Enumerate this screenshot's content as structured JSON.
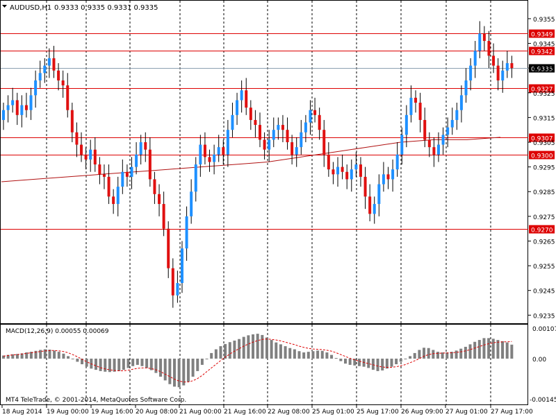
{
  "header": {
    "symbol_label": "AUDUSD,H1",
    "ohlc_label": "0.9333 0.9335 0.9331 0.9335"
  },
  "macd": {
    "label": "MACD(12,26,9) 0.00055 0.00069",
    "scale_labels": [
      "0.00107",
      "0.00",
      "-0.00145"
    ]
  },
  "copyright": "MT4 TeleTrade, © 2001-2014, MetaQuotes Software Corp.",
  "price_axis": {
    "tick_labels": [
      "0.9355",
      "0.9345",
      "0.9335",
      "0.9325",
      "0.9315",
      "0.9305",
      "0.9295",
      "0.9285",
      "0.9275",
      "0.9265",
      "0.9255",
      "0.9245",
      "0.9235"
    ]
  },
  "levels": [
    {
      "label": "0.9349",
      "value": 0.9349
    },
    {
      "label": "0.9342",
      "value": 0.9342
    },
    {
      "label": "0.9327",
      "value": 0.9327
    },
    {
      "label": "0.9307",
      "value": 0.9307
    },
    {
      "label": "0.9300",
      "value": 0.93
    },
    {
      "label": "0.9270",
      "value": 0.927
    }
  ],
  "current_price": {
    "label": "0.9335",
    "value": 0.9335
  },
  "time_axis": {
    "labels": [
      "18 Aug 2014",
      "19 Aug 00:00",
      "19 Aug 16:00",
      "20 Aug 08:00",
      "21 Aug 00:00",
      "21 Aug 16:00",
      "22 Aug 08:00",
      "25 Aug 01:00",
      "25 Aug 17:00",
      "26 Aug 09:00",
      "27 Aug 01:00",
      "27 Aug 17:00"
    ]
  },
  "colors": {
    "bull": "#1e90ff",
    "bear": "#e01010",
    "level_line": "#dd0000",
    "current_line": "#8ca0b0",
    "ma_line": "#b01010",
    "macd_hist": "#808080",
    "macd_signal": "#dd0000",
    "grid": "#000000"
  },
  "chart_data": [
    {
      "type": "candlestick",
      "symbol": "AUDUSD",
      "timeframe": "H1",
      "ylim": [
        0.9232,
        0.9362
      ],
      "ma_series": [
        0.9289,
        0.929,
        0.9291,
        0.9292,
        0.9293,
        0.9294,
        0.9295,
        0.9296,
        0.9297,
        0.9299,
        0.9301,
        0.9303,
        0.9305,
        0.9306,
        0.9306,
        0.9307
      ],
      "close_series": [
        0.9318,
        0.932,
        0.9322,
        0.9316,
        0.932,
        0.9318,
        0.9324,
        0.933,
        0.9333,
        0.9336,
        0.9339,
        0.9334,
        0.933,
        0.9328,
        0.9318,
        0.9309,
        0.9304,
        0.93,
        0.9298,
        0.9302,
        0.9296,
        0.9292,
        0.9291,
        0.9283,
        0.928,
        0.9287,
        0.9293,
        0.9291,
        0.9295,
        0.93,
        0.9305,
        0.9302,
        0.929,
        0.9284,
        0.928,
        0.927,
        0.9254,
        0.9243,
        0.9248,
        0.9262,
        0.9275,
        0.9285,
        0.9296,
        0.9304,
        0.9299,
        0.9297,
        0.93,
        0.9303,
        0.93,
        0.931,
        0.9316,
        0.9322,
        0.9326,
        0.9319,
        0.9314,
        0.9312,
        0.9306,
        0.9302,
        0.9306,
        0.931,
        0.9312,
        0.931,
        0.9305,
        0.93,
        0.9303,
        0.9309,
        0.9313,
        0.9318,
        0.9316,
        0.931,
        0.93,
        0.9294,
        0.9292,
        0.9295,
        0.9293,
        0.929,
        0.9294,
        0.9296,
        0.9291,
        0.9283,
        0.9276,
        0.928,
        0.9288,
        0.9292,
        0.929,
        0.9294,
        0.93,
        0.9308,
        0.9316,
        0.9323,
        0.9321,
        0.9314,
        0.9306,
        0.9303,
        0.93,
        0.9304,
        0.9308,
        0.9311,
        0.9314,
        0.9318,
        0.9324,
        0.933,
        0.9336,
        0.9342,
        0.9349,
        0.9346,
        0.934,
        0.9336,
        0.933,
        0.9334,
        0.9337,
        0.9335
      ]
    },
    {
      "type": "bar",
      "name": "MACD(12,26,9)",
      "ylim": [
        -0.00145,
        0.00107
      ],
      "values": [
        0.0001,
        0.00012,
        0.00014,
        0.00015,
        0.00017,
        0.0002,
        0.00022,
        0.00025,
        0.00028,
        0.0003,
        0.00029,
        0.00026,
        0.00022,
        0.00016,
        8e-05,
        -2e-05,
        -0.0001,
        -0.00018,
        -0.00026,
        -0.00032,
        -0.00036,
        -0.0004,
        -0.00042,
        -0.00043,
        -0.00042,
        -0.0004,
        -0.00036,
        -0.0003,
        -0.00024,
        -0.0002,
        -0.00024,
        -0.0003,
        -0.00037,
        -0.00046,
        -0.00058,
        -0.0007,
        -0.00082,
        -0.0009,
        -0.00092,
        -0.00086,
        -0.00074,
        -0.00058,
        -0.0004,
        -0.0002,
        0.0,
        0.00018,
        0.0003,
        0.0004,
        0.00047,
        0.00053,
        0.00058,
        0.00063,
        0.0007,
        0.00075,
        0.00078,
        0.0008,
        0.00076,
        0.00068,
        0.0006,
        0.00052,
        0.00046,
        0.0004,
        0.00034,
        0.0003,
        0.00024,
        0.0002,
        0.00022,
        0.00024,
        0.00026,
        0.00025,
        0.0002,
        0.00012,
        2e-05,
        -8e-05,
        -0.00016,
        -0.0002,
        -0.00022,
        -0.00024,
        -0.00026,
        -0.0003,
        -0.00036,
        -0.0004,
        -0.00038,
        -0.00032,
        -0.00026,
        -0.00018,
        -0.0001,
        -2e-05,
        8e-05,
        0.00018,
        0.00028,
        0.00035,
        0.00034,
        0.00028,
        0.00022,
        0.0002,
        0.0002,
        0.00022,
        0.00026,
        0.00032,
        0.00038,
        0.00046,
        0.00054,
        0.0006,
        0.00066,
        0.00066,
        0.00064,
        0.0006,
        0.00056,
        0.00052,
        0.00045
      ],
      "signal": [
        8e-05,
        0.0001,
        0.00012,
        0.00013,
        0.00015,
        0.00017,
        0.00019,
        0.00021,
        0.00023,
        0.00025,
        0.00026,
        0.00026,
        0.00025,
        0.00023,
        0.00019,
        0.00013,
        6e-05,
        -2e-05,
        -0.0001,
        -0.00017,
        -0.00023,
        -0.00029,
        -0.00033,
        -0.00036,
        -0.00038,
        -0.00039,
        -0.00039,
        -0.00037,
        -0.00034,
        -0.00031,
        -0.0003,
        -0.0003,
        -0.00032,
        -0.00036,
        -0.00042,
        -0.0005,
        -0.00058,
        -0.00066,
        -0.00072,
        -0.00075,
        -0.00075,
        -0.00071,
        -0.00064,
        -0.00054,
        -0.00042,
        -0.0003,
        -0.00018,
        -6e-05,
        5e-05,
        0.00015,
        0.00024,
        0.00032,
        0.0004,
        0.00047,
        0.00053,
        0.00058,
        0.00062,
        0.00063,
        0.00062,
        0.0006,
        0.00057,
        0.00053,
        0.00049,
        0.00045,
        0.0004,
        0.00036,
        0.00033,
        0.00031,
        0.0003,
        0.00029,
        0.00027,
        0.00024,
        0.00019,
        0.00013,
        7e-05,
        1e-05,
        -4e-05,
        -8e-05,
        -0.00012,
        -0.00016,
        -0.0002,
        -0.00024,
        -0.00027,
        -0.00028,
        -0.00028,
        -0.00026,
        -0.00023,
        -0.00019,
        -0.00013,
        -7e-05,
        0.0,
        8e-05,
        0.00013,
        0.00016,
        0.00017,
        0.00018,
        0.00018,
        0.00019,
        0.0002,
        0.00022,
        0.00025,
        0.00029,
        0.00034,
        0.00039,
        0.00044,
        0.00048,
        0.00051,
        0.00053,
        0.00054,
        0.00054,
        0.00055
      ]
    }
  ]
}
